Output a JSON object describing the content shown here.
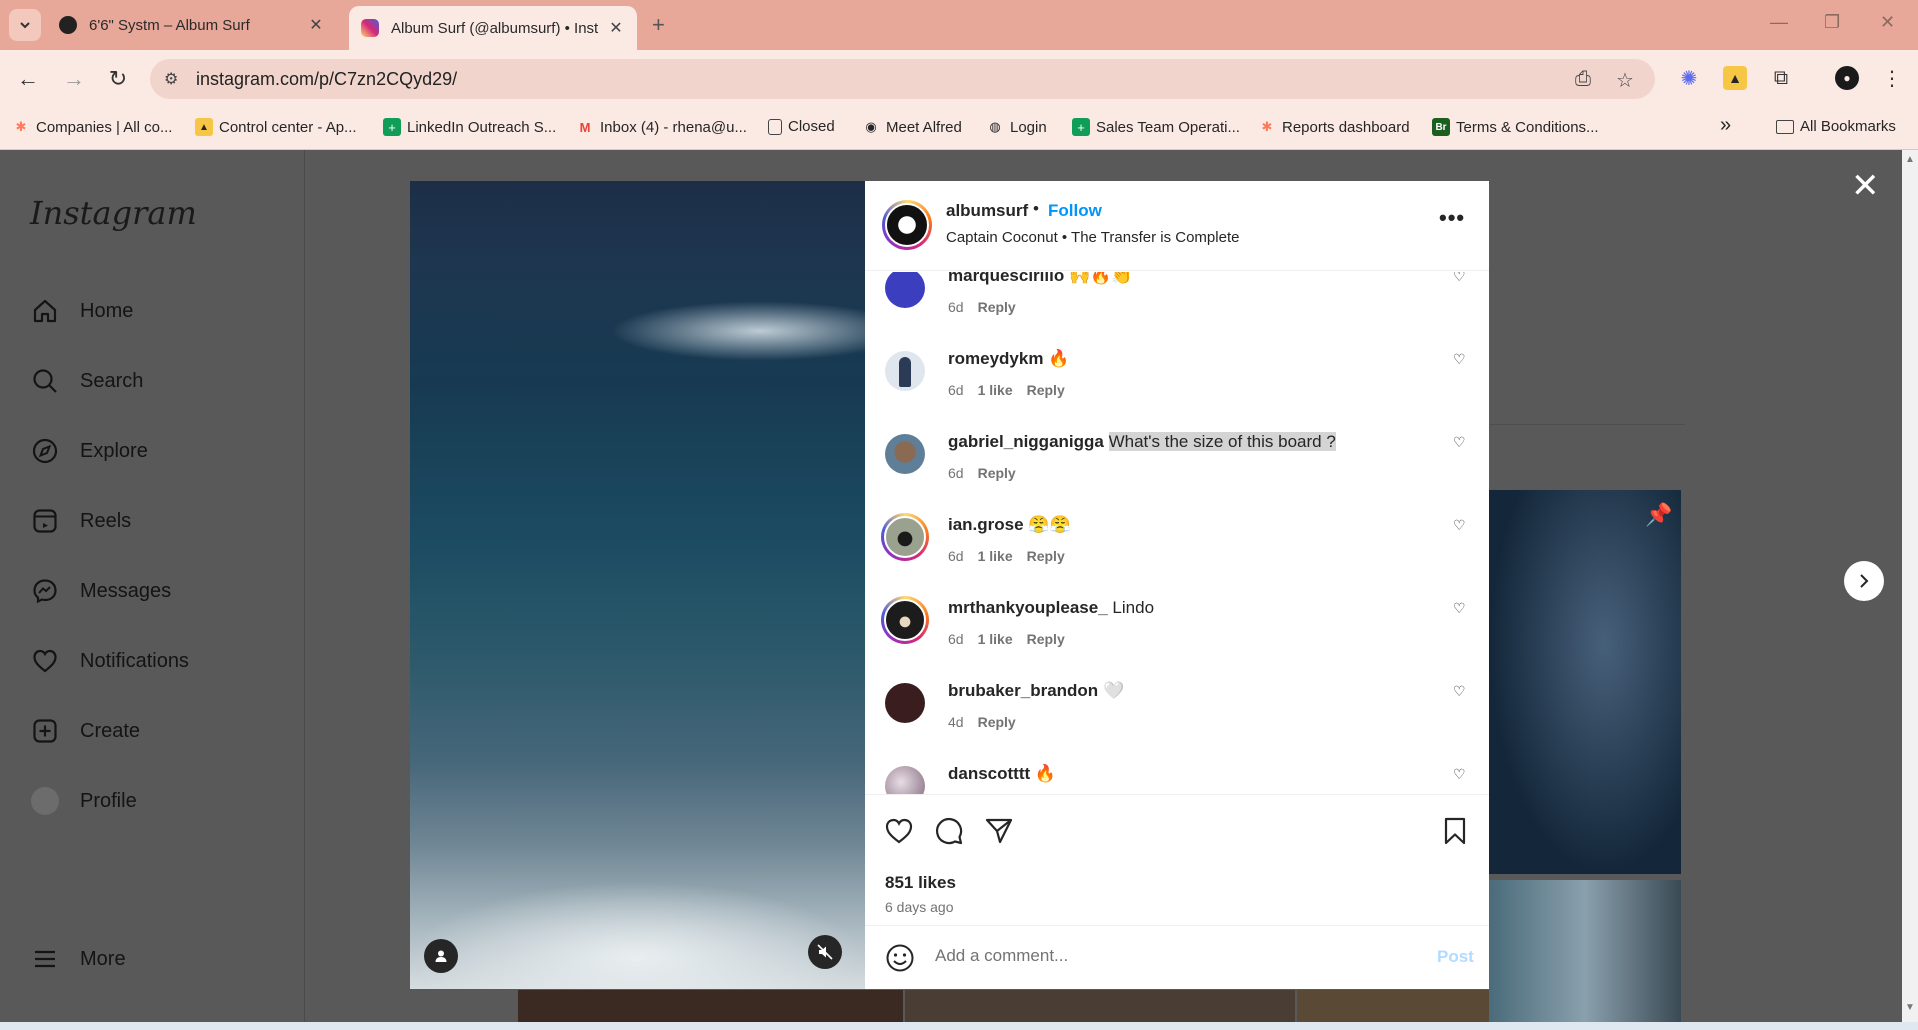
{
  "browser": {
    "tabs": [
      {
        "title": "6'6\" Systm – Album Surf",
        "active": false
      },
      {
        "title": "Album Surf (@albumsurf) • Inst",
        "active": true
      }
    ],
    "new_tab": "+",
    "url": "instagram.com/p/C7zn2CQyd29/",
    "bookmarks": [
      {
        "label": "Companies | All co...",
        "icon": "hubspot-icon",
        "color": "#ff7a59"
      },
      {
        "label": "Control center - Ap...",
        "icon": "apollo-icon",
        "color": "#f6c644"
      },
      {
        "label": "LinkedIn Outreach S...",
        "icon": "sheets-icon",
        "color": "#0f9d58"
      },
      {
        "label": "Inbox (4) - rhena@u...",
        "icon": "gmail-icon",
        "color": "#ea4335"
      },
      {
        "label": "Closed",
        "icon": "page-icon",
        "color": "#444444"
      },
      {
        "label": "Meet Alfred",
        "icon": "alfred-icon",
        "color": "#222222"
      },
      {
        "label": "Login",
        "icon": "globe-icon",
        "color": "#222222"
      },
      {
        "label": "Sales Team Operati...",
        "icon": "sheets-icon",
        "color": "#0f9d58"
      },
      {
        "label": "Reports dashboard",
        "icon": "hubspot-icon",
        "color": "#ff7a59"
      },
      {
        "label": "Terms & Conditions...",
        "icon": "br-icon",
        "color": "#1b5e20"
      }
    ],
    "more_bookmarks": "»",
    "all_bookmarks": "All Bookmarks"
  },
  "sidebar": {
    "logo": "Instagram",
    "items": [
      {
        "label": "Home",
        "icon": "home-icon"
      },
      {
        "label": "Search",
        "icon": "search-icon"
      },
      {
        "label": "Explore",
        "icon": "compass-icon"
      },
      {
        "label": "Reels",
        "icon": "reels-icon"
      },
      {
        "label": "Messages",
        "icon": "messenger-icon"
      },
      {
        "label": "Notifications",
        "icon": "heart-icon"
      },
      {
        "label": "Create",
        "icon": "plus-square-icon"
      },
      {
        "label": "Profile",
        "icon": "profile-avatar"
      }
    ],
    "more": "More"
  },
  "post": {
    "username": "albumsurf",
    "separator": "•",
    "follow": "Follow",
    "subtitle": "Captain Coconut • The Transfer is Complete",
    "comments": [
      {
        "user": "marquescirillo",
        "text": "🙌🔥👏",
        "age": "6d",
        "likes": "",
        "reply": "Reply",
        "avatar_color": "#3b3fbf",
        "highlight": false,
        "ring": false
      },
      {
        "user": "romeydykm",
        "text": "🔥",
        "age": "6d",
        "likes": "1 like",
        "reply": "Reply",
        "avatar_color": "#dfe6ee",
        "highlight": false,
        "ring": false
      },
      {
        "user": "gabriel_nigganigga",
        "text": "What's the size of this board ?",
        "age": "6d",
        "likes": "",
        "reply": "Reply",
        "avatar_color": "#7a6a5a",
        "highlight": true,
        "ring": false
      },
      {
        "user": "ian.grose",
        "text": "😤😤",
        "age": "6d",
        "likes": "1 like",
        "reply": "Reply",
        "avatar_color": "#9aa28f",
        "highlight": false,
        "ring": true
      },
      {
        "user": "mrthankyouplease_",
        "text": "Lindo",
        "age": "6d",
        "likes": "1 like",
        "reply": "Reply",
        "avatar_color": "#1c1c1c",
        "highlight": false,
        "ring": true
      },
      {
        "user": "brubaker_brandon",
        "text": "🤍",
        "age": "4d",
        "likes": "",
        "reply": "Reply",
        "avatar_color": "#3a1d1f",
        "highlight": false,
        "ring": false
      },
      {
        "user": "danscotttt",
        "text": "🔥",
        "age": "",
        "likes": "",
        "reply": "",
        "avatar_color": "#b9a8b5",
        "highlight": false,
        "ring": false
      }
    ],
    "likes": "851 likes",
    "time_ago": "6 days ago",
    "comment_placeholder": "Add a comment...",
    "post_button": "Post"
  },
  "colors": {
    "accent": "#0095f6",
    "tabbar": "#e8a899"
  }
}
